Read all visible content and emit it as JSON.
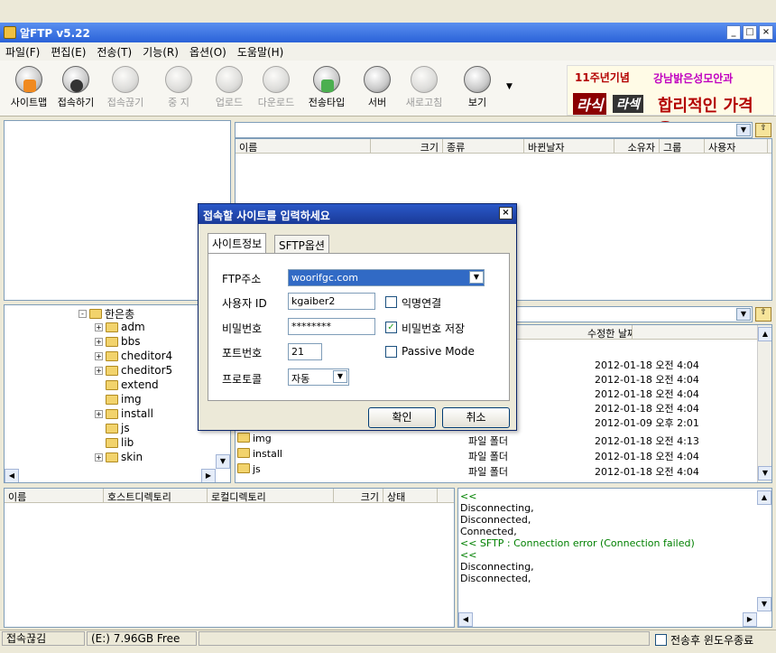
{
  "window": {
    "title": "알FTP v5.22"
  },
  "menu": [
    "파일(F)",
    "편집(E)",
    "전송(T)",
    "기능(R)",
    "옵션(O)",
    "도움말(H)"
  ],
  "toolbar": {
    "buttons": [
      {
        "label": "사이트맵",
        "enabled": true
      },
      {
        "label": "접속하기",
        "enabled": true
      },
      {
        "label": "접속끊기",
        "enabled": false
      },
      {
        "label": "중 지",
        "enabled": false
      },
      {
        "label": "업로드",
        "enabled": false
      },
      {
        "label": "다운로드",
        "enabled": false
      },
      {
        "label": "전송타입",
        "enabled": true
      },
      {
        "label": "서버",
        "enabled": true
      },
      {
        "label": "새로고침",
        "enabled": false
      },
      {
        "label": "보기",
        "enabled": true
      }
    ]
  },
  "ad": {
    "line1": "11주년기념",
    "line1b": "강남밝은성모안과",
    "brand": "라식",
    "brand2": "라섹",
    "slogan": "합리적인 가격은?"
  },
  "remote": {
    "columns": [
      "이름",
      "크기",
      "종류",
      "바뀐날자",
      "소유자",
      "그룹",
      "사용자"
    ]
  },
  "local": {
    "tree": [
      {
        "name": "한은총",
        "expand": "-"
      },
      {
        "name": "adm",
        "expand": "+"
      },
      {
        "name": "bbs",
        "expand": "+"
      },
      {
        "name": "cheditor4",
        "expand": "+"
      },
      {
        "name": "cheditor5",
        "expand": "+"
      },
      {
        "name": "extend",
        "expand": ""
      },
      {
        "name": "img",
        "expand": ""
      },
      {
        "name": "install",
        "expand": "+"
      },
      {
        "name": "js",
        "expand": ""
      },
      {
        "name": "lib",
        "expand": ""
      },
      {
        "name": "skin",
        "expand": "+"
      }
    ],
    "date_header": "수정한 날짜",
    "dates": [
      "2012-01-18 오전 4:04",
      "2012-01-18 오전 4:04",
      "2012-01-18 오전 4:04",
      "2012-01-18 오전 4:04",
      "2012-01-09 오후 2:01"
    ],
    "files": [
      {
        "name": "img",
        "type": "파일 폴더",
        "date": "2012-01-18 오전 4:13"
      },
      {
        "name": "install",
        "type": "파일 폴더",
        "date": "2012-01-18 오전 4:04"
      },
      {
        "name": "js",
        "type": "파일 폴더",
        "date": "2012-01-18 오전 4:04"
      }
    ]
  },
  "queue": {
    "columns": [
      "이름",
      "호스트디렉토리",
      "로컬디렉토리",
      "크기",
      "상태"
    ]
  },
  "log": [
    {
      "text": "<<",
      "color": "#008000"
    },
    {
      "text": "Disconnecting,",
      "color": "#000000"
    },
    {
      "text": "Disconnected,",
      "color": "#000000"
    },
    {
      "text": "Connected,",
      "color": "#000000"
    },
    {
      "text": "<< SFTP : Connection error (Connection failed)",
      "color": "#008000"
    },
    {
      "text": "<<",
      "color": "#008000"
    },
    {
      "text": "Disconnecting,",
      "color": "#000000"
    },
    {
      "text": "Disconnected,",
      "color": "#000000"
    }
  ],
  "status": {
    "connection": "접속끊김",
    "drive": "(E:) 7.96GB Free",
    "auto_close_label": "전송후 윈도우종료"
  },
  "dialog": {
    "title": "접속할 사이트를 입력하세요",
    "tabs": [
      "사이트정보",
      "SFTP옵션"
    ],
    "ftp_label": "FTP주소",
    "ftp_value": "woorifgc.com",
    "user_label": "사용자 ID",
    "user_value": "kgaiber2",
    "anon_label": "익명연결",
    "pw_label": "비밀번호",
    "pw_value": "********",
    "save_pw_label": "비밀번호 저장",
    "port_label": "포트번호",
    "port_value": "21",
    "passive_label": "Passive Mode",
    "proto_label": "프로토콜",
    "proto_value": "자동",
    "ok_label": "확인",
    "cancel_label": "취소"
  }
}
